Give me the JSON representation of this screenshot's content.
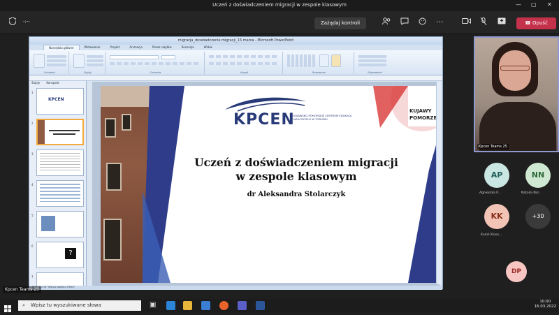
{
  "window": {
    "title": "Uczeń z doświadczeniem migracji w zespole klasowym",
    "controls": [
      "—",
      "▢",
      "✕"
    ]
  },
  "teams_toolbar": {
    "timer": "-:--",
    "request_control_label": "Zażądaj kontroli",
    "leave_label": "Opuść"
  },
  "powerpoint": {
    "title": "migracja_doswiadczenie migracji_15 marca - Microsoft PowerPoint",
    "tabs": [
      "Narzędzia główne",
      "Wstawianie",
      "Projekt",
      "Animacje",
      "Pokaz slajdów",
      "Recenzja",
      "Widok"
    ],
    "ribbon_groups": [
      "Schowek",
      "Slajdy",
      "Czcionka",
      "Akapit",
      "Rysowanie",
      "Edytowanie"
    ],
    "pane_tabs": [
      "Slajdy",
      "Konspekt"
    ],
    "thumb_numbers": [
      "1",
      "2",
      "3",
      "4",
      "5",
      "6",
      "7"
    ],
    "status_text": "Slajd 2 z 16     \"Motyw pakietu Office\"",
    "slide": {
      "logo_text": "KPCEN",
      "logo_subtitle": "KUJAWSKO-POMORSKIE CENTRUM EDUKACJI NAUCZYCIELI W TORUNIU",
      "region_line1": "KUJAWY",
      "region_line2": "POMORZE",
      "title_line1": "Uczeń z doświadczeniem migracji",
      "title_line2": "w zespole klasowym",
      "author": "dr Aleksandra Stolarczyk"
    }
  },
  "participants": {
    "video_name": "Kpcen Teams 25",
    "people": [
      {
        "initials": "AP",
        "name": "Agnieszka P...",
        "color": "#c9e6e2",
        "text_color": "#1f5c57"
      },
      {
        "initials": "NN",
        "name": "Natalia Nal...",
        "color": "#cfe8d2",
        "text_color": "#2f6b3a"
      },
      {
        "initials": "KK",
        "name": "Kamil Kloso...",
        "color": "#f2c4b6",
        "text_color": "#8a2f1c"
      },
      {
        "initials": "DP",
        "name": "",
        "color": "#f7c6c3",
        "text_color": "#9a2b26"
      }
    ],
    "more_count": "+30",
    "presenter_label": "Kpcen Teams 25"
  },
  "taskbar": {
    "search_placeholder": "Wpisz tu wyszukiwane słowa",
    "time": "10:00",
    "date": "16.03.2022"
  }
}
